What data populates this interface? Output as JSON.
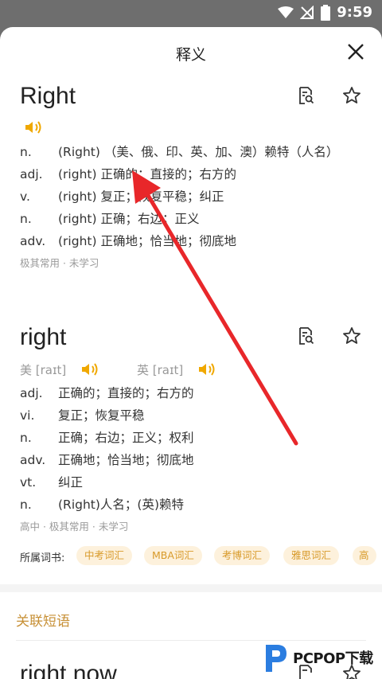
{
  "status": {
    "time": "9:59"
  },
  "header": {
    "title": "释义"
  },
  "entry1": {
    "word": "Right",
    "definitions": [
      {
        "pos": "n.",
        "text": "(Right) （美、俄、印、英、加、澳）赖特（人名）"
      },
      {
        "pos": "adj.",
        "text": "(right) 正确的；直接的；右方的"
      },
      {
        "pos": "v.",
        "text": "(right) 复正；恢复平稳；纠正"
      },
      {
        "pos": "n.",
        "text": "(right) 正确；右边；正义"
      },
      {
        "pos": "adv.",
        "text": "(right) 正确地；恰当地；彻底地"
      }
    ],
    "frequency": "极其常用 · 未学习"
  },
  "entry2": {
    "word": "right",
    "phonetic_us": "美 [raɪt]",
    "phonetic_uk": "英 [raɪt]",
    "definitions": [
      {
        "pos": "adj.",
        "text": "正确的；直接的；右方的"
      },
      {
        "pos": "vi.",
        "text": "复正；恢复平稳"
      },
      {
        "pos": "n.",
        "text": "正确；右边；正义；权利"
      },
      {
        "pos": "adv.",
        "text": "正确地；恰当地；彻底地"
      },
      {
        "pos": "vt.",
        "text": "纠正"
      },
      {
        "pos": "n.",
        "text": "(Right)人名；(英)赖特"
      }
    ],
    "frequency": "高中 · 极其常用 · 未学习",
    "books_label": "所属词书:",
    "books": [
      "中考词汇",
      "MBA词汇",
      "考博词汇",
      "雅思词汇",
      "高"
    ]
  },
  "related": {
    "title": "关联短语",
    "first_phrase": "right now"
  },
  "watermark": {
    "text": "PCPOP下载"
  },
  "colors": {
    "accent": "#c79036",
    "speaker": "#f0a800",
    "arrow": "#e8272a"
  }
}
